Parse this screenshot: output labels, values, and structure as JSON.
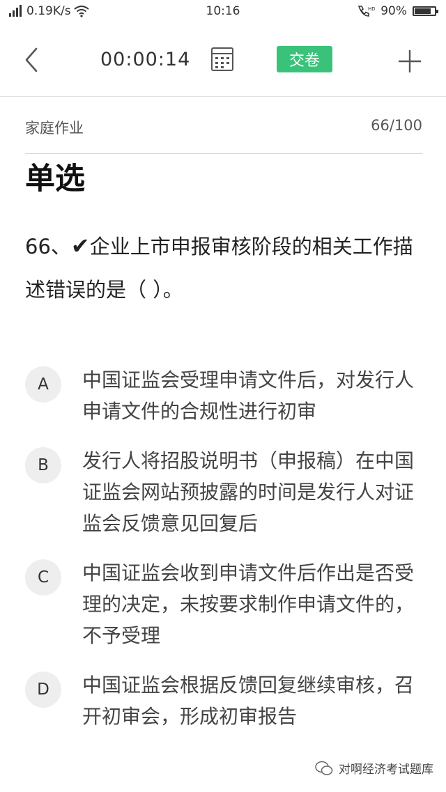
{
  "status_bar": {
    "network_speed": "0.19K/s",
    "time": "10:16",
    "battery": "90%",
    "battery_level": 0.9
  },
  "toolbar": {
    "timer": "00:00:14",
    "submit_label": "交卷"
  },
  "section": {
    "title": "家庭作业",
    "progress": "66/100"
  },
  "question": {
    "type": "单选",
    "number": "66、",
    "mark": "✔",
    "text": "企业上市申报审核阶段的相关工作描述错误的是（ ）。"
  },
  "options": [
    {
      "letter": "A",
      "text": "中国证监会受理申请文件后，对发行人申请文件的合规性进行初审"
    },
    {
      "letter": "B",
      "text": "发行人将招股说明书（申报稿）在中国证监会网站预披露的时间是发行人对证监会反馈意见回复后"
    },
    {
      "letter": "C",
      "text": "中国证监会收到申请文件后作出是否受理的决定，未按要求制作申请文件的，不予受理"
    },
    {
      "letter": "D",
      "text": "中国证监会根据反馈回复继续审核，召开初审会，形成初审报告"
    }
  ],
  "watermark": "对啊经济考试题库"
}
